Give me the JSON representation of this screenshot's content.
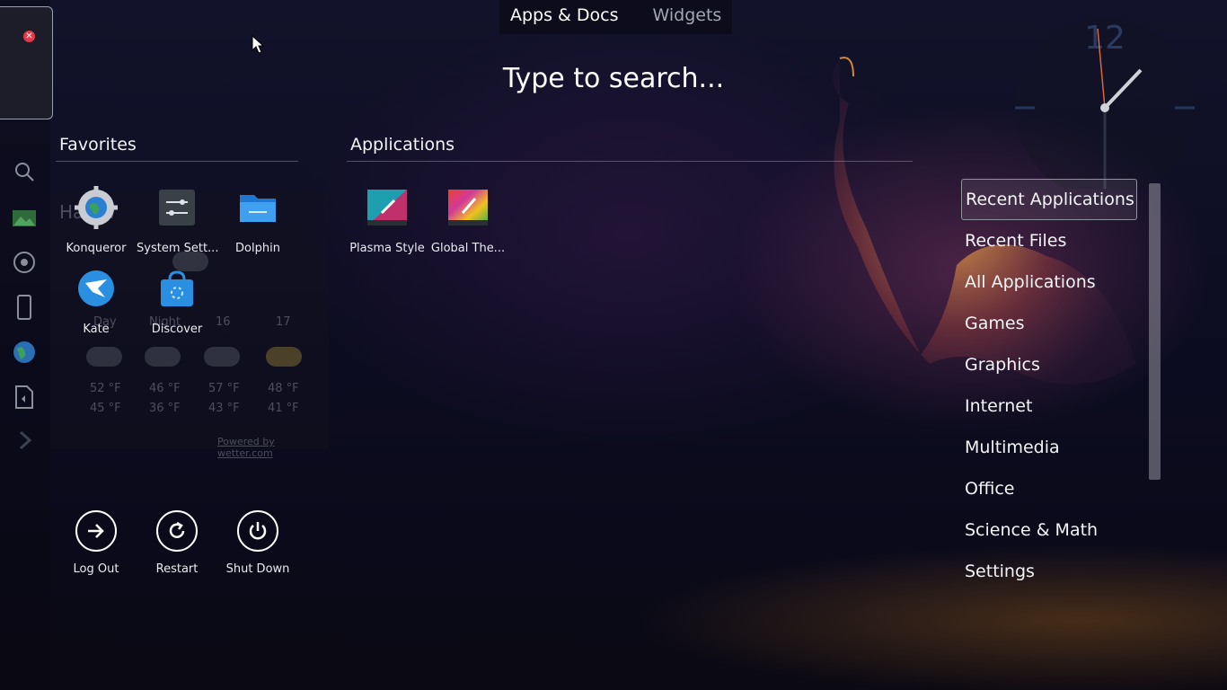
{
  "tabs": [
    {
      "label": "Apps & Docs",
      "active": true
    },
    {
      "label": "Widgets",
      "active": false
    }
  ],
  "search": {
    "placeholder": "Type to search..."
  },
  "favorites": {
    "title": "Favorites",
    "items": [
      {
        "label": "Konqueror",
        "icon": "konqueror-icon"
      },
      {
        "label": "System Sett...",
        "icon": "system-settings-icon"
      },
      {
        "label": "Dolphin",
        "icon": "dolphin-folder-icon"
      },
      {
        "label": "Kate",
        "icon": "kate-icon"
      },
      {
        "label": "Discover",
        "icon": "discover-icon"
      }
    ]
  },
  "applications": {
    "title": "Applications",
    "items": [
      {
        "label": "Plasma Style",
        "icon": "plasma-style-icon"
      },
      {
        "label": "Global The...",
        "icon": "global-theme-icon"
      }
    ]
  },
  "power": [
    {
      "label": "Log Out",
      "icon": "logout-icon"
    },
    {
      "label": "Restart",
      "icon": "restart-icon"
    },
    {
      "label": "Shut Down",
      "icon": "shutdown-icon"
    }
  ],
  "categories": [
    {
      "label": "Recent Applications",
      "selected": true
    },
    {
      "label": "Recent Files"
    },
    {
      "label": "All Applications"
    },
    {
      "label": "Games"
    },
    {
      "label": "Graphics"
    },
    {
      "label": "Internet"
    },
    {
      "label": "Multimedia"
    },
    {
      "label": "Office"
    },
    {
      "label": "Science & Math"
    },
    {
      "label": "Settings"
    }
  ],
  "weather_widget": {
    "location": "Ha...w",
    "day_label": "Day",
    "night_label": "Night",
    "dates": [
      "16",
      "17"
    ],
    "highs": [
      "52 °F",
      "46 °F",
      "57 °F",
      "48 °F"
    ],
    "lows": [
      "45 °F",
      "36 °F",
      "43 °F",
      "41 °F"
    ],
    "credit": "Powered by wetter.com"
  },
  "clock": {
    "hour_mark": "12"
  },
  "colors": {
    "accent_selected_border": "#8d929c",
    "close_red": "#e03b4a"
  }
}
